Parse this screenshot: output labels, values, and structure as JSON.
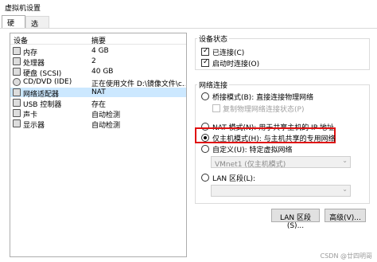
{
  "window": {
    "title": "虚拟机设置"
  },
  "tabs": [
    {
      "label": "硬件"
    },
    {
      "label": "选项"
    }
  ],
  "devices": {
    "col_device": "设备",
    "col_summary": "摘要",
    "rows": [
      {
        "name": "内存",
        "summary": "4 GB",
        "icon": "memory-icon"
      },
      {
        "name": "处理器",
        "summary": "2",
        "icon": "cpu-icon"
      },
      {
        "name": "硬盘 (SCSI)",
        "summary": "40 GB",
        "icon": "hard-disk-icon"
      },
      {
        "name": "CD/DVD (IDE)",
        "summary": "正在使用文件 D:\\镜像文件\\c...",
        "icon": "cd-dvd-icon"
      },
      {
        "name": "网络适配器",
        "summary": "NAT",
        "icon": "network-adapter-icon"
      },
      {
        "name": "USB 控制器",
        "summary": "存在",
        "icon": "usb-icon"
      },
      {
        "name": "声卡",
        "summary": "自动检测",
        "icon": "sound-card-icon"
      },
      {
        "name": "显示器",
        "summary": "自动检测",
        "icon": "display-icon"
      }
    ]
  },
  "device_status": {
    "label": "设备状态",
    "connected": "已连接(C)",
    "connect_on_power": "启动时连接(O)"
  },
  "network": {
    "label": "网络连接",
    "bridged": "桥接模式(B): 直接连接物理网络",
    "replicate": "复制物理网络连接状态(P)",
    "nat": "NAT 模式(N): 用于共享主机的 IP 地址",
    "host_only": "仅主机模式(H): 与主机共享的专用网络",
    "custom": "自定义(U): 特定虚拟网络",
    "vmnet_value": "VMnet1 (仅主机模式)",
    "lan_segment": "LAN 区段(L):",
    "lan_value": ""
  },
  "buttons": {
    "lan": "LAN 区段(S)...",
    "advanced": "高级(V)..."
  },
  "watermark": "CSDN @廿四明哥"
}
